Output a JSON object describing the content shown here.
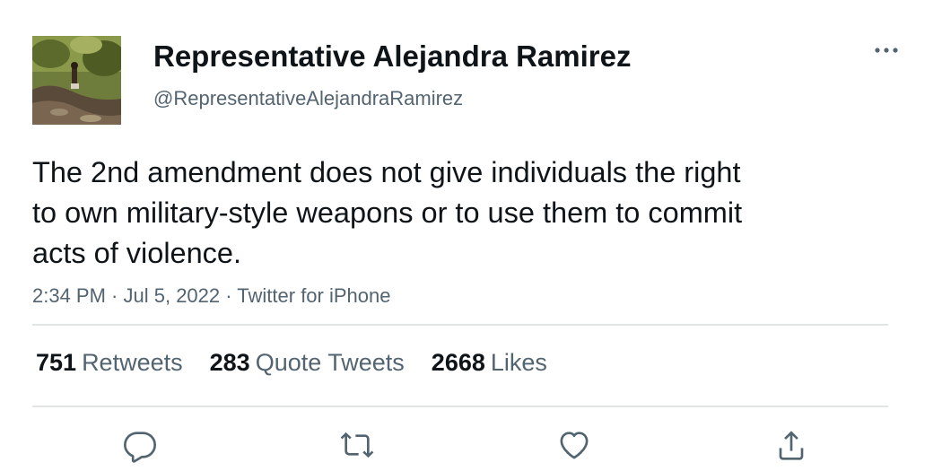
{
  "tweet": {
    "author": {
      "display_name": "Representative Alejandra Ramirez",
      "handle": "@RepresentativeAlejandraRamirez",
      "avatar_icon": "profile-photo"
    },
    "text_lines": [
      "The 2nd amendment does not give individuals the right",
      "to own military-style weapons or to use them to commit",
      "acts of violence."
    ],
    "meta": {
      "time": "2:34 PM",
      "date": "Jul 5, 2022",
      "source": "Twitter for iPhone",
      "separator": " · "
    },
    "stats": {
      "retweets_count": "751",
      "retweets_label": "Retweets",
      "quotes_count": "283",
      "quotes_label": "Quote Tweets",
      "likes_count": "2668",
      "likes_label": "Likes"
    },
    "actions": [
      "reply-icon",
      "retweet-icon",
      "like-icon",
      "share-icon"
    ],
    "more_icon": "more-icon"
  },
  "colors": {
    "text_primary": "#0f1419",
    "text_secondary": "#536471",
    "divider": "#e1e5e8",
    "icon": "#536471"
  }
}
